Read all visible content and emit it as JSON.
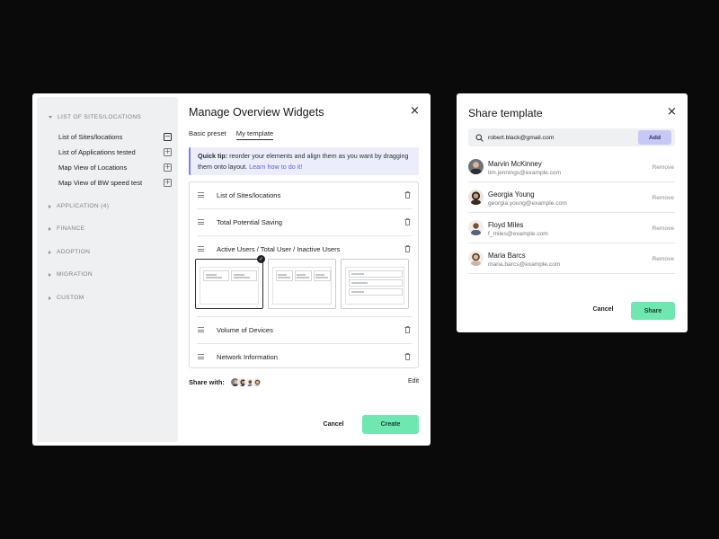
{
  "left_modal": {
    "title": "Manage Overview Widgets",
    "tabs": [
      {
        "label": "Basic preset",
        "active": false
      },
      {
        "label": "My template",
        "active": true
      }
    ],
    "tip": {
      "bold": "Quick tip:",
      "text": " reorder your elements and align them as you want by dragging them onto layout. ",
      "link": "Learn how to do it!"
    },
    "widgets": [
      {
        "label": "List of Sites/locations"
      },
      {
        "label": "Total Potential Saving"
      },
      {
        "label": "Active Users / Total User / Inactive Users"
      },
      {
        "label": "Volume of Devices"
      },
      {
        "label": "Network Information"
      }
    ],
    "layout_options": [
      "two-column",
      "three-column",
      "stacked-rows"
    ],
    "selected_layout": "two-column",
    "share_with_label": "Share with:",
    "edit_label": "Edit",
    "cancel_label": "Cancel",
    "create_label": "Create"
  },
  "sidebar": {
    "sections": [
      {
        "label": "LIST OF SITES/LOCATIONS",
        "expanded": true
      },
      {
        "label": "APPLICATION (4)",
        "expanded": false
      },
      {
        "label": "FINANCE",
        "expanded": false
      },
      {
        "label": "ADOPTION",
        "expanded": false
      },
      {
        "label": "MIGRATION",
        "expanded": false
      },
      {
        "label": "CUSTOM",
        "expanded": false
      }
    ],
    "items": [
      {
        "label": "List of Sites/locations",
        "state": "added"
      },
      {
        "label": "List of Applications tested",
        "state": "add"
      },
      {
        "label": "Map View of Locations",
        "state": "add"
      },
      {
        "label": "Map View of BW speed test",
        "state": "add"
      }
    ]
  },
  "right_modal": {
    "title": "Share template",
    "input_value": "robert.black@gmail.com",
    "add_label": "Add",
    "members": [
      {
        "name": "Marvin McKinney",
        "email": "tim.jennings@example.com",
        "remove": "Remove"
      },
      {
        "name": "Georgia Young",
        "email": "georgia.young@example.com",
        "remove": "Remove"
      },
      {
        "name": "Floyd Miles",
        "email": "f_miles@example.com",
        "remove": "Remove"
      },
      {
        "name": "Maria Barcs",
        "email": "maria.barcs@example.com",
        "remove": "Remove"
      }
    ],
    "cancel_label": "Cancel",
    "share_label": "Share"
  },
  "colors": {
    "accent_green": "#6ee7b0",
    "accent_purple": "#c7c8f5",
    "tip_bg": "#ecedfb",
    "link": "#5b5fdc"
  }
}
